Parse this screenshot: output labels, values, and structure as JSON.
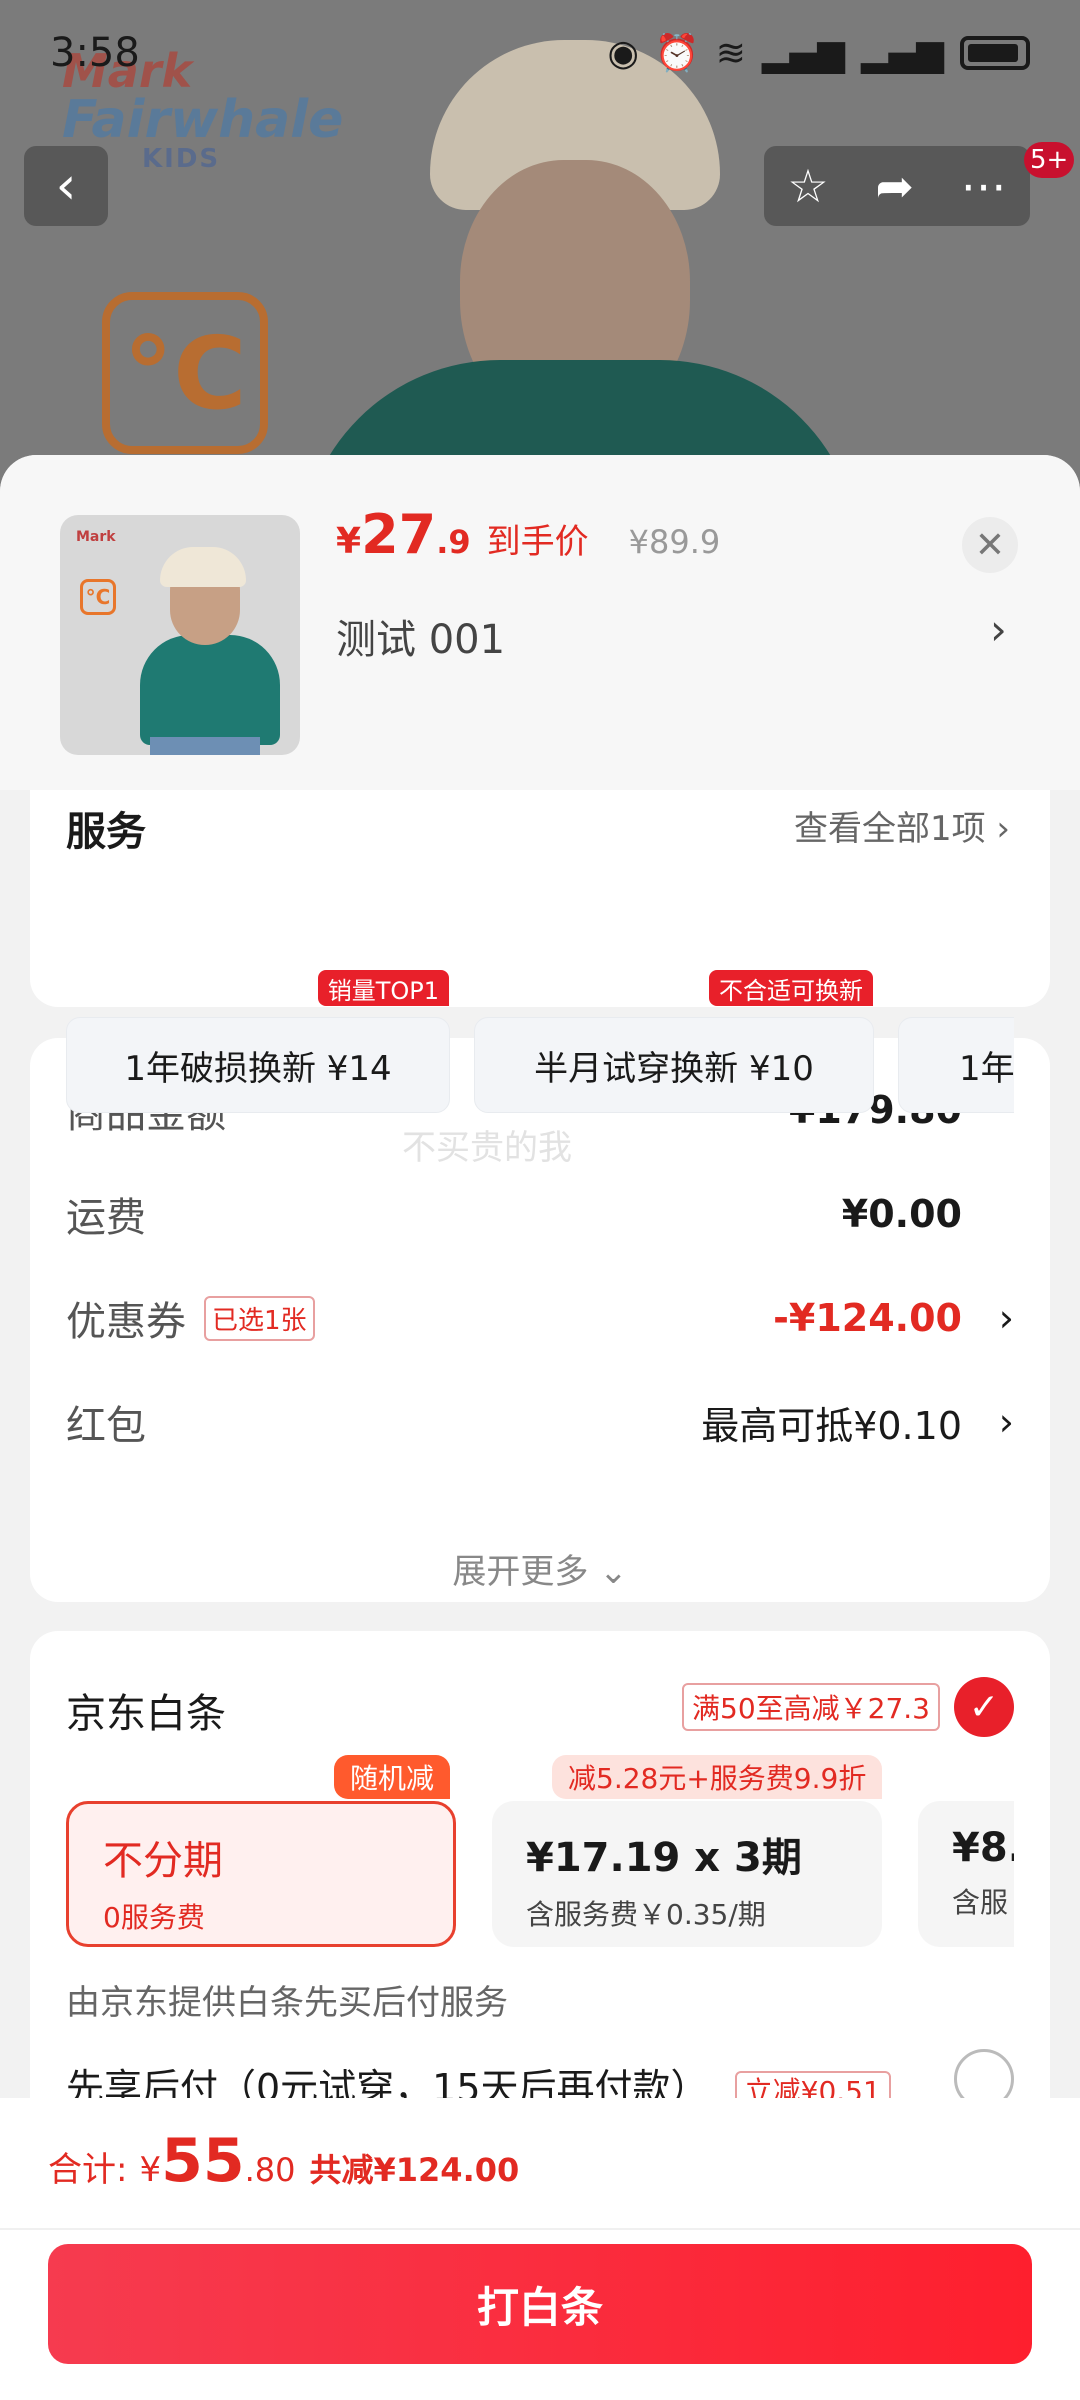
{
  "status_bar": {
    "time": "3:58"
  },
  "background": {
    "brand_logo_line1": "Mark",
    "brand_logo_line2": "Fairwhale",
    "brand_logo_line3": "KIDS",
    "badge_count": "5+"
  },
  "product": {
    "price_symbol": "¥",
    "price_int": "27",
    "price_dec": ".9",
    "price_tag": "到手价",
    "original_price": "¥89.9",
    "variant": "测试  001"
  },
  "services": {
    "title": "服务",
    "more": "查看全部1项",
    "items": [
      {
        "label": "1年破损换新  ¥14",
        "badge": "销量TOP1"
      },
      {
        "label": "半月试穿换新  ¥10",
        "badge": "不合适可换新"
      },
      {
        "label": "1年",
        "badge": ""
      }
    ]
  },
  "price_summary": {
    "watermark": "不买贵的我",
    "rows": [
      {
        "label": "商品金额",
        "value": "¥179.80"
      },
      {
        "label": "运费",
        "value": "¥0.00"
      },
      {
        "label": "优惠券",
        "tag": "已选1张",
        "value": "-¥124.00"
      },
      {
        "label": "红包",
        "value": "最高可抵¥0.10"
      }
    ],
    "expand": "展开更多"
  },
  "baitiao": {
    "title": "京东白条",
    "promo": "满50至高减￥27.3",
    "plans": [
      {
        "main": "不分期",
        "sub": "0服务费",
        "badge": "随机减"
      },
      {
        "main": "¥17.19 x 3期",
        "sub": "含服务费￥0.35/期",
        "badge": "减5.28元+服务费9.9折"
      },
      {
        "main": "¥8.",
        "sub": "含服",
        "badge": ""
      }
    ],
    "note": "由京东提供白条先买后付服务",
    "next_option": "先享后付（0元试穿，15天后再付款）",
    "next_promo": "立减¥0.51"
  },
  "footer": {
    "total_label": "合计:",
    "total_symbol": "¥",
    "total_int": "55",
    "total_dec": ".80",
    "total_saved": "共减¥124.00",
    "pay_button": "打白条"
  }
}
